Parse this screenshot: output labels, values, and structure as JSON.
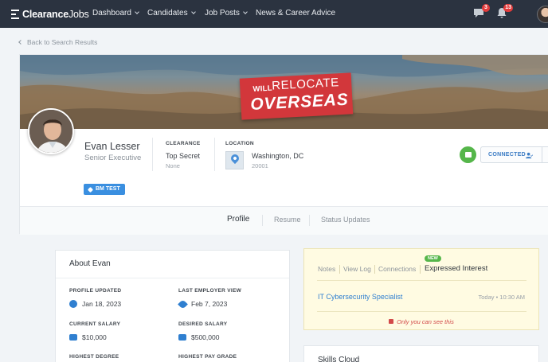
{
  "nav": {
    "logo_bold": "Clearance",
    "logo_light": "Jobs",
    "items": [
      {
        "label": "Dashboard"
      },
      {
        "label": "Candidates"
      },
      {
        "label": "Job Posts"
      },
      {
        "label": "News & Career Advice"
      }
    ],
    "messages_count": "3",
    "notifications_count": "13"
  },
  "back_link": "Back to Search Results",
  "banner": {
    "line1_small": "WILL",
    "line1_big": "RELOCATE",
    "line2": "OVERSEAS"
  },
  "profile": {
    "name": "Evan Lesser",
    "title": "Senior Executive",
    "clearance_label": "CLEARANCE",
    "clearance_value": "Top Secret",
    "clearance_sub": "None",
    "location_label": "LOCATION",
    "location_value": "Washington, DC",
    "location_zip": "20001",
    "connected_label": "CONNECTED",
    "tag": "BM TEST"
  },
  "tabs": [
    {
      "label": "Profile"
    },
    {
      "label": "Resume"
    },
    {
      "label": "Status Updates"
    }
  ],
  "about": {
    "title": "About Evan",
    "fields": [
      {
        "label": "PROFILE UPDATED",
        "value": "Jan 18, 2023"
      },
      {
        "label": "LAST EMPLOYER VIEW",
        "value": "Feb 7, 2023"
      },
      {
        "label": "CURRENT SALARY",
        "value": "$10,000"
      },
      {
        "label": "DESIRED SALARY",
        "value": "$500,000"
      },
      {
        "label": "HIGHEST DEGREE",
        "value": ""
      },
      {
        "label": "HIGHEST PAY GRADE",
        "value": ""
      }
    ]
  },
  "interest": {
    "tabs": [
      {
        "label": "Notes"
      },
      {
        "label": "View Log"
      },
      {
        "label": "Connections"
      },
      {
        "label": "Expressed Interest"
      }
    ],
    "new_badge": "NEW",
    "job_title": "IT Cybersecurity Specialist",
    "job_time": "Today • 10:30 AM",
    "private_note": "Only you can see this"
  },
  "skills": {
    "title": "Skills Cloud"
  },
  "colors": {
    "nav_bg": "#2b3340",
    "accent_blue": "#2f7fd0",
    "badge_red": "#e23b3b",
    "chat_green": "#55b64a",
    "banner_red": "#d2373b",
    "interest_bg": "#fffbe2"
  },
  "icons": {
    "messages": "chat-bubble-icon",
    "notifications": "bell-icon",
    "connected": "person-check-icon",
    "chat": "chat-icon",
    "location": "map-pin-icon",
    "tag": "tag-icon",
    "profile_updated": "refresh-icon",
    "employer_view": "eye-icon",
    "salary": "wallet-icon",
    "private": "lock-icon"
  }
}
